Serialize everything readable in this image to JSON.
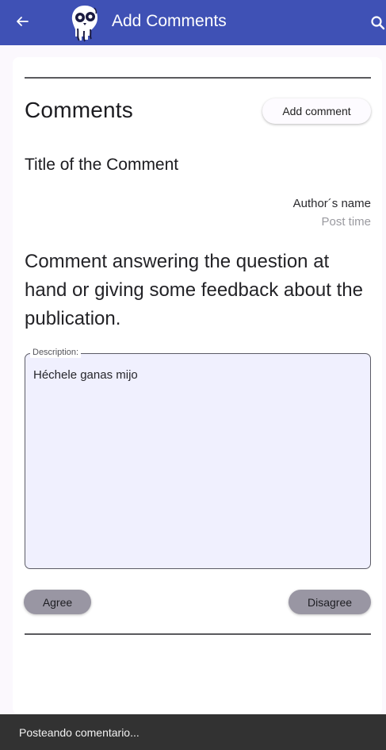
{
  "appbar": {
    "title": "Add Comments",
    "back_icon": "arrow-left-icon",
    "logo_icon": "skull-logo-icon",
    "search_icon": "search-icon"
  },
  "comments": {
    "heading": "Comments",
    "add_button_label": "Add comment",
    "comment_title": "Title of the Comment",
    "author": "Author´s name",
    "post_time": "Post time",
    "body": "Comment answering the question at hand or giving some feedback about the publication."
  },
  "description": {
    "label": "Description:",
    "value": "Héchele ganas mijo"
  },
  "actions": {
    "agree_label": "Agree",
    "disagree_label": "Disagree"
  },
  "snackbar": {
    "message": "Posteando comentario..."
  },
  "colors": {
    "appbar": "#3f51b5",
    "field_bg": "#f0f0fe",
    "pill_bg": "#9996a3",
    "snackbar_bg": "#323232"
  }
}
